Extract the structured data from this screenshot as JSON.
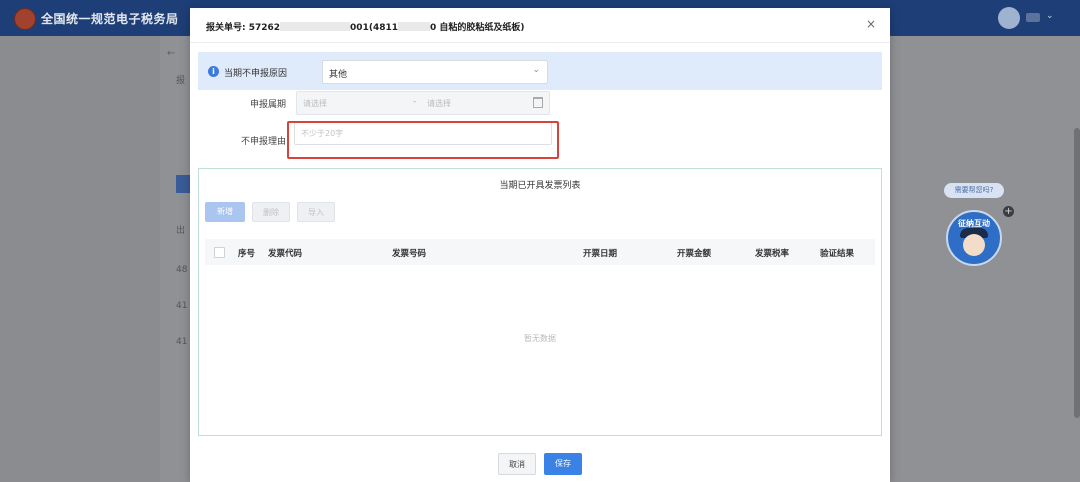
{
  "site": {
    "title": "全国统一规范电子税务局"
  },
  "modal": {
    "title_prefix": "报关单号: 57262",
    "title_mid": "001(4811",
    "title_suffix": "0 自粘的胶粘纸及纸板)",
    "close_glyph": "×"
  },
  "notice": {
    "label": "当期不申报原因",
    "selected": "其他",
    "caret": "⌄"
  },
  "form": {
    "period_label": "申报属期",
    "period_start_placeholder": "请选择",
    "period_separator": "-",
    "period_end_placeholder": "请选择",
    "reason_label": "不申报理由",
    "reason_placeholder": "不少于20字",
    "reason_value": ""
  },
  "invoice_list": {
    "title": "当期已开具发票列表",
    "buttons": {
      "add": "新增",
      "delete": "删除",
      "import": "导入"
    },
    "columns": [
      "序号",
      "发票代码",
      "发票号码",
      "开票日期",
      "开票金额",
      "发票税率",
      "验证结果"
    ],
    "empty_text": "暂无数据"
  },
  "footer": {
    "cancel": "取消",
    "save": "保存"
  },
  "assistant": {
    "bubble": "需要帮您吗?",
    "label": "征纳互动",
    "plus": "+"
  },
  "background": {
    "back_arrow": "←",
    "left_fragments": [
      "报",
      "出",
      "48",
      "41",
      "41"
    ]
  },
  "colors": {
    "header_bg": "#1e3e78",
    "primary": "#3a82e6",
    "highlight_border": "#d9423a",
    "notice_bg": "#dfeafb",
    "panel_border": "#bfe0da"
  }
}
